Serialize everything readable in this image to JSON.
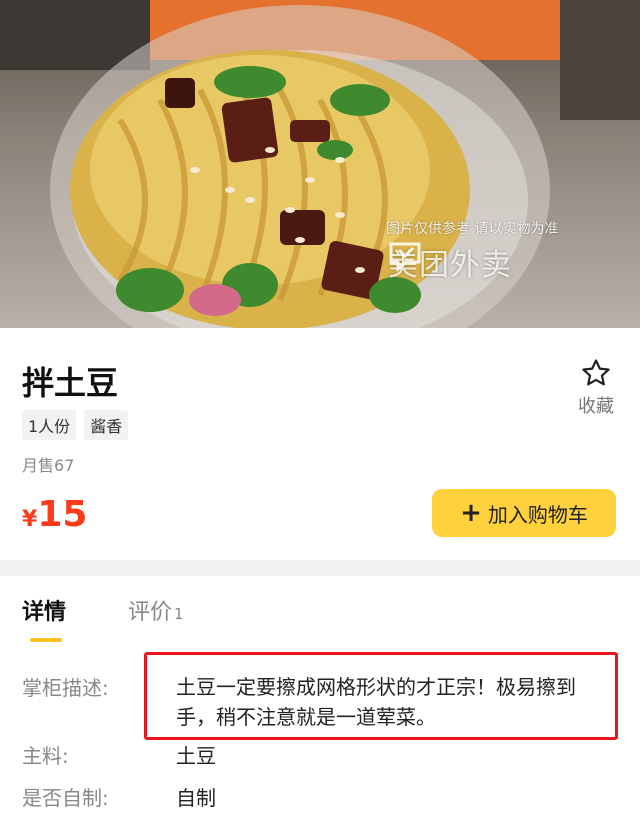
{
  "photo": {
    "watermark_note": "图片仅供参考 请以实物为准",
    "watermark_brand": "美团外卖"
  },
  "product": {
    "name": "拌土豆",
    "tags": [
      "1人份",
      "酱香"
    ],
    "sales": "月售67",
    "price_currency": "¥",
    "price_value": "15",
    "favorite_label": "收藏",
    "add_to_cart_label": "加入购物车"
  },
  "tabs": {
    "detail_label": "详情",
    "reviews_label": "评价",
    "reviews_count": "1"
  },
  "details": {
    "description_label": "掌柜描述:",
    "description_text": "土豆一定要擦成网格形状的才正宗！极易擦到手，稍不注意就是一道荤菜。",
    "ingredient_label": "主料:",
    "ingredient_value": "土豆",
    "homemade_label": "是否自制:",
    "homemade_value": "自制"
  },
  "colors": {
    "price": "#ff3a1a",
    "cart_button": "#ffd23d",
    "tab_indicator": "#ffc21a",
    "highlight_box": "#e8141a"
  }
}
